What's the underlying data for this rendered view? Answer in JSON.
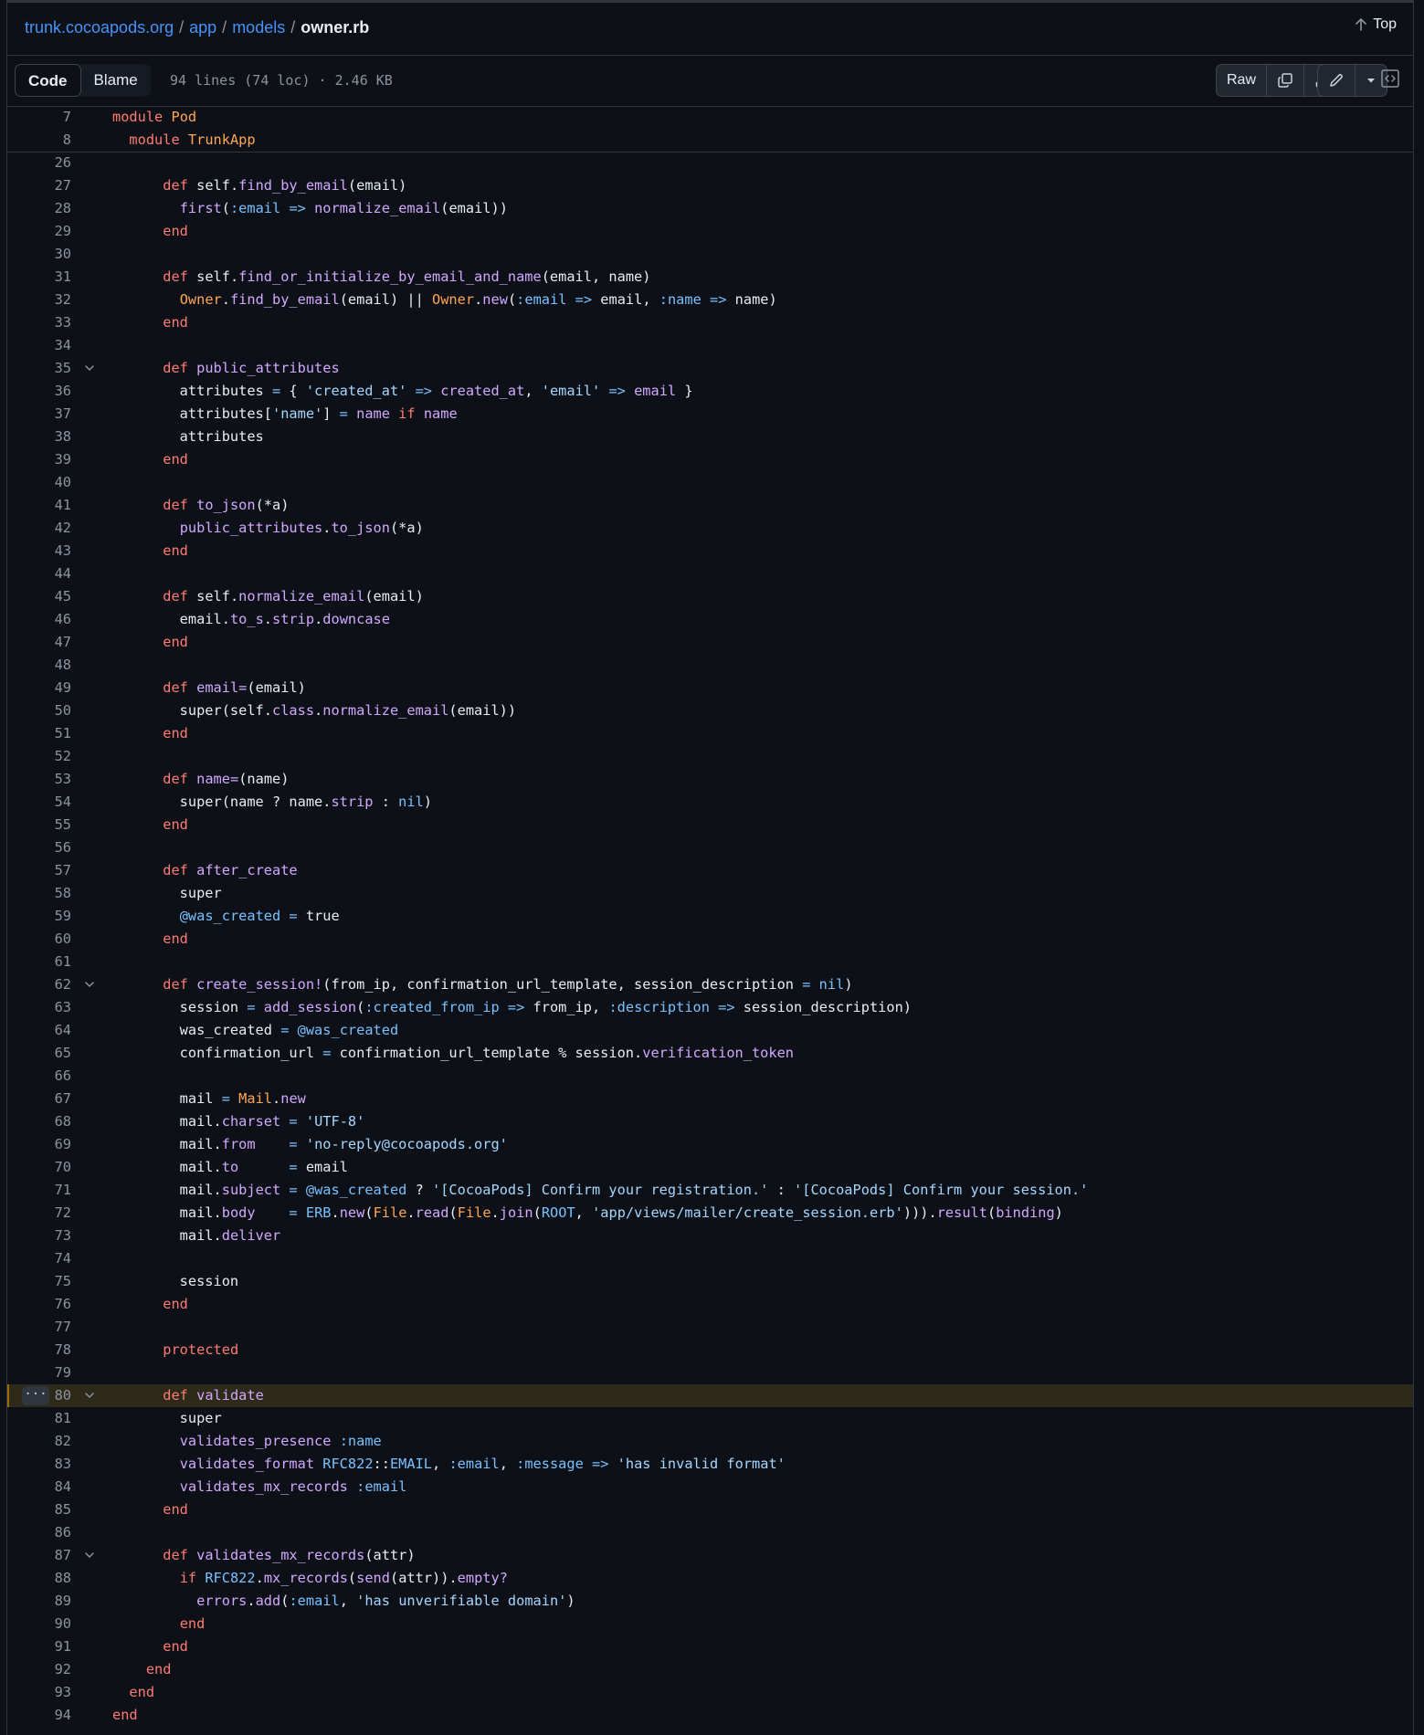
{
  "breadcrumb": {
    "repo": "trunk.cocoapods.org",
    "dir1": "app",
    "dir2": "models",
    "file": "owner.rb"
  },
  "top_label": "Top",
  "tabs": {
    "code": "Code",
    "blame": "Blame"
  },
  "file_meta": "94 lines (74 loc) · 2.46 KB",
  "raw_label": "Raw",
  "sticky_lines": [
    {
      "n": "7",
      "html": "<span class='kw'>module</span> <span class='cn'>Pod</span>"
    },
    {
      "n": "8",
      "html": "  <span class='kw'>module</span> <span class='cn'>TrunkApp</span>"
    }
  ],
  "code_lines": [
    {
      "n": "26",
      "html": ""
    },
    {
      "n": "27",
      "html": "      <span class='kw'>def</span> self.<span class='fn'>find_by_email</span>(email)"
    },
    {
      "n": "28",
      "html": "        <span class='fn'>first</span>(<span class='sy'>:email</span> <span class='op'>=&gt;</span> <span class='fn'>normalize_email</span>(email))"
    },
    {
      "n": "29",
      "html": "      <span class='kw'>end</span>"
    },
    {
      "n": "30",
      "html": ""
    },
    {
      "n": "31",
      "html": "      <span class='kw'>def</span> self.<span class='fn'>find_or_initialize_by_email_and_name</span>(email, name)"
    },
    {
      "n": "32",
      "html": "        <span class='cn'>Owner</span>.<span class='fn'>find_by_email</span>(email) || <span class='cn'>Owner</span>.<span class='fn'>new</span>(<span class='sy'>:email</span> <span class='op'>=&gt;</span> email, <span class='sy'>:name</span> <span class='op'>=&gt;</span> name)"
    },
    {
      "n": "33",
      "html": "      <span class='kw'>end</span>"
    },
    {
      "n": "34",
      "html": ""
    },
    {
      "n": "35",
      "fold": true,
      "html": "      <span class='kw'>def</span> <span class='fn'>public_attributes</span>"
    },
    {
      "n": "36",
      "html": "        attributes <span class='op'>=</span> { <span class='st'>'created_at'</span> <span class='op'>=&gt;</span> <span class='fn'>created_at</span>, <span class='st'>'email'</span> <span class='op'>=&gt;</span> <span class='fn'>email</span> }"
    },
    {
      "n": "37",
      "html": "        attributes[<span class='st'>'name'</span>] <span class='op'>=</span> <span class='fn'>name</span> <span class='kw'>if</span> <span class='fn'>name</span>"
    },
    {
      "n": "38",
      "html": "        attributes"
    },
    {
      "n": "39",
      "html": "      <span class='kw'>end</span>"
    },
    {
      "n": "40",
      "html": ""
    },
    {
      "n": "41",
      "html": "      <span class='kw'>def</span> <span class='fn'>to_json</span>(*a)"
    },
    {
      "n": "42",
      "html": "        <span class='fn'>public_attributes</span>.<span class='fn'>to_json</span>(*a)"
    },
    {
      "n": "43",
      "html": "      <span class='kw'>end</span>"
    },
    {
      "n": "44",
      "html": ""
    },
    {
      "n": "45",
      "html": "      <span class='kw'>def</span> self.<span class='fn'>normalize_email</span>(email)"
    },
    {
      "n": "46",
      "html": "        email.<span class='fn'>to_s</span>.<span class='fn'>strip</span>.<span class='fn'>downcase</span>"
    },
    {
      "n": "47",
      "html": "      <span class='kw'>end</span>"
    },
    {
      "n": "48",
      "html": ""
    },
    {
      "n": "49",
      "html": "      <span class='kw'>def</span> <span class='fn'>email=</span>(email)"
    },
    {
      "n": "50",
      "html": "        super(self.<span class='fn'>class</span>.<span class='fn'>normalize_email</span>(email))"
    },
    {
      "n": "51",
      "html": "      <span class='kw'>end</span>"
    },
    {
      "n": "52",
      "html": ""
    },
    {
      "n": "53",
      "html": "      <span class='kw'>def</span> <span class='fn'>name=</span>(name)"
    },
    {
      "n": "54",
      "html": "        super(name ? name.<span class='fn'>strip</span> : <span class='sy'>nil</span>)"
    },
    {
      "n": "55",
      "html": "      <span class='kw'>end</span>"
    },
    {
      "n": "56",
      "html": ""
    },
    {
      "n": "57",
      "html": "      <span class='kw'>def</span> <span class='fn'>after_create</span>"
    },
    {
      "n": "58",
      "html": "        super"
    },
    {
      "n": "59",
      "html": "        <span class='sy'>@was_created</span> <span class='op'>=</span> true"
    },
    {
      "n": "60",
      "html": "      <span class='kw'>end</span>"
    },
    {
      "n": "61",
      "html": ""
    },
    {
      "n": "62",
      "fold": true,
      "html": "      <span class='kw'>def</span> <span class='fn'>create_session!</span>(from_ip, confirmation_url_template, session_description <span class='op'>=</span> <span class='sy'>nil</span>)"
    },
    {
      "n": "63",
      "html": "        session <span class='op'>=</span> <span class='fn'>add_session</span>(<span class='sy'>:created_from_ip</span> <span class='op'>=&gt;</span> from_ip, <span class='sy'>:description</span> <span class='op'>=&gt;</span> session_description)"
    },
    {
      "n": "64",
      "html": "        was_created <span class='op'>=</span> <span class='sy'>@was_created</span>"
    },
    {
      "n": "65",
      "html": "        confirmation_url <span class='op'>=</span> confirmation_url_template % session.<span class='fn'>verification_token</span>"
    },
    {
      "n": "66",
      "html": ""
    },
    {
      "n": "67",
      "html": "        mail <span class='op'>=</span> <span class='cn'>Mail</span>.<span class='fn'>new</span>"
    },
    {
      "n": "68",
      "html": "        mail.<span class='fn'>charset</span> <span class='op'>=</span> <span class='st'>'UTF-8'</span>"
    },
    {
      "n": "69",
      "html": "        mail.<span class='fn'>from</span>    <span class='op'>=</span> <span class='st'>'no-reply@cocoapods.org'</span>"
    },
    {
      "n": "70",
      "html": "        mail.<span class='fn'>to</span>      <span class='op'>=</span> email"
    },
    {
      "n": "71",
      "html": "        mail.<span class='fn'>subject</span> <span class='op'>=</span> <span class='sy'>@was_created</span> ? <span class='st'>'[CocoaPods] Confirm your registration.'</span> : <span class='st'>'[CocoaPods] Confirm your session.'</span>"
    },
    {
      "n": "72",
      "html": "        mail.<span class='fn'>body</span>    <span class='op'>=</span> <span class='sy'>ERB</span>.<span class='fn'>new</span>(<span class='cn'>File</span>.<span class='fn'>read</span>(<span class='cn'>File</span>.<span class='fn'>join</span>(<span class='sy'>ROOT</span>, <span class='st'>'app/views/mailer/create_session.erb'</span>))).<span class='fn'>result</span>(<span class='fn'>binding</span>)"
    },
    {
      "n": "73",
      "html": "        mail.<span class='fn'>deliver</span>"
    },
    {
      "n": "74",
      "html": ""
    },
    {
      "n": "75",
      "html": "        session"
    },
    {
      "n": "76",
      "html": "      <span class='kw'>end</span>"
    },
    {
      "n": "77",
      "html": ""
    },
    {
      "n": "78",
      "html": "      <span class='kw'>protected</span>"
    },
    {
      "n": "79",
      "html": ""
    },
    {
      "n": "80",
      "fold": true,
      "highlight": true,
      "html": "      <span class='kw'>def</span> <span class='fn'>validate</span>"
    },
    {
      "n": "81",
      "html": "        super"
    },
    {
      "n": "82",
      "html": "        <span class='fn'>validates_presence</span> <span class='sy'>:name</span>"
    },
    {
      "n": "83",
      "html": "        <span class='fn'>validates_format</span> <span class='sy'>RFC822</span>::<span class='sy'>EMAIL</span>, <span class='sy'>:email</span>, <span class='sy'>:message</span> <span class='op'>=&gt;</span> <span class='st'>'has invalid format'</span>"
    },
    {
      "n": "84",
      "html": "        <span class='fn'>validates_mx_records</span> <span class='sy'>:email</span>"
    },
    {
      "n": "85",
      "html": "      <span class='kw'>end</span>"
    },
    {
      "n": "86",
      "html": ""
    },
    {
      "n": "87",
      "fold": true,
      "html": "      <span class='kw'>def</span> <span class='fn'>validates_mx_records</span>(attr)"
    },
    {
      "n": "88",
      "html": "        <span class='kw'>if</span> <span class='sy'>RFC822</span>.<span class='fn'>mx_records</span>(<span class='fn'>send</span>(attr)).<span class='fn'>empty?</span>"
    },
    {
      "n": "89",
      "html": "          <span class='fn'>errors</span>.<span class='fn'>add</span>(<span class='sy'>:email</span>, <span class='st'>'has unverifiable domain'</span>)"
    },
    {
      "n": "90",
      "html": "        <span class='kw'>end</span>"
    },
    {
      "n": "91",
      "html": "      <span class='kw'>end</span>"
    },
    {
      "n": "92",
      "html": "    <span class='kw'>end</span>"
    },
    {
      "n": "93",
      "html": "  <span class='kw'>end</span>"
    },
    {
      "n": "94",
      "html": "<span class='kw'>end</span>"
    }
  ]
}
